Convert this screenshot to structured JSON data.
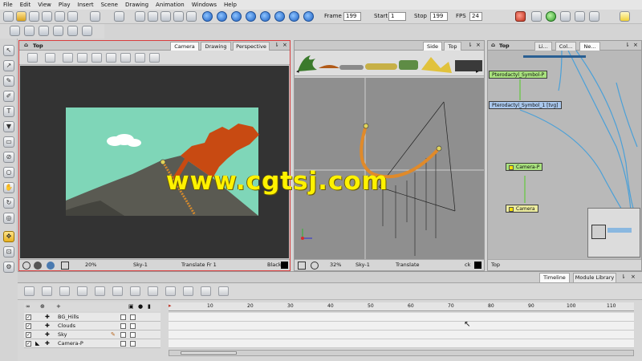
{
  "menu": [
    "File",
    "Edit",
    "View",
    "Play",
    "Insert",
    "Scene",
    "Drawing",
    "Animation",
    "Windows",
    "Help"
  ],
  "playback": {
    "frame_label": "Frame",
    "frame_value": "199",
    "start_label": "Start",
    "start_value": "1",
    "stop_label": "Stop",
    "stop_value": "199",
    "fps_label": "FPS",
    "fps_value": "24"
  },
  "camera_view": {
    "top_label": "Top",
    "tabs": [
      "Camera",
      "Drawing",
      "Perspective"
    ],
    "zoom": "20%",
    "drawing": "Sky-1",
    "mode": "Translate Fr 1",
    "bg": "Black"
  },
  "side_view": {
    "tabs": [
      "Side",
      "Top"
    ],
    "zoom": "32%",
    "drawing": "Sky-1",
    "mode": "Translate",
    "bg": "ck"
  },
  "node_view": {
    "top_label": "Top",
    "tabs": [
      "Li...",
      "Col...",
      "Ne..."
    ],
    "nodes": [
      "Pterodactyl_Symbol-P",
      "Pterodactyl_Symbol_1 [tvg]",
      "Camera-P",
      "Camera"
    ],
    "breadcrumb": "Top"
  },
  "timeline": {
    "tabs": [
      "Timeline",
      "Module Library"
    ],
    "ruler": [
      "10",
      "20",
      "30",
      "40",
      "50",
      "60",
      "70",
      "80",
      "90",
      "100",
      "110"
    ],
    "layers": [
      "BG_Hills",
      "Clouds",
      "Sky",
      "Camera-P"
    ]
  },
  "watermark": "www.cgtsj.com",
  "colors": {
    "selected_border": "#d83d3d",
    "sky": "#7fd6b8",
    "hill": "#5a5a52",
    "lava": "#c84a12",
    "node_green": "#a9e27e",
    "node_blue": "#a9c7ec",
    "node_yellow": "#ecec9f"
  }
}
